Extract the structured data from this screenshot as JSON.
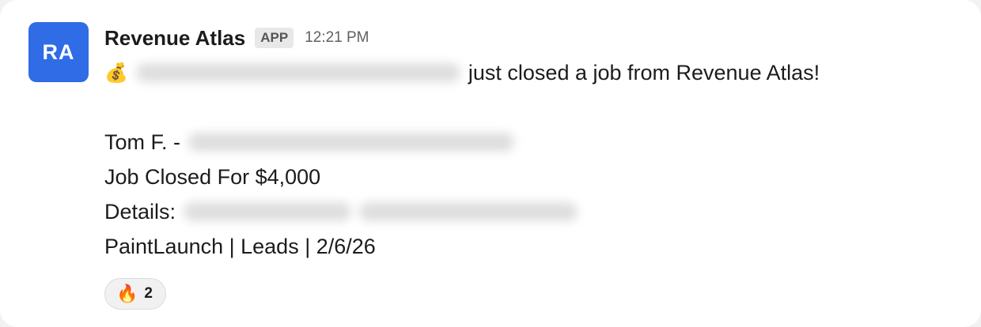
{
  "message": {
    "avatar_initials": "RA",
    "avatar_color": "#2f6ce6",
    "sender": "Revenue Atlas",
    "badge": "APP",
    "time": "12:21 PM",
    "line1_emoji": "💰",
    "line1_text": "just closed a job from Revenue Atlas!",
    "line2_prefix": "Tom F. -",
    "line3": "Job Closed For $4,000",
    "line4_prefix": "Details:",
    "line5": "PaintLaunch | Leads | 2/6/26"
  },
  "reaction": {
    "emoji": "🔥",
    "count": "2"
  }
}
